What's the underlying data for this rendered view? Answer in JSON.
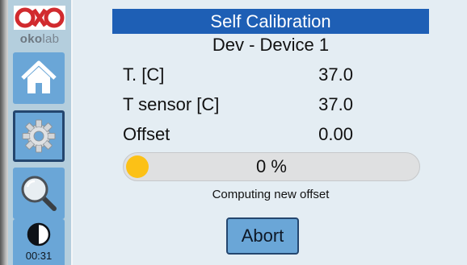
{
  "sidebar": {
    "logo": {
      "text_prefix": "oko",
      "text_suffix": "lab"
    },
    "buttons": [
      {
        "name": "home",
        "icon": "home-icon",
        "selected": false
      },
      {
        "name": "settings",
        "icon": "gear-icon",
        "selected": true
      },
      {
        "name": "search",
        "icon": "magnifier-icon",
        "selected": false
      }
    ],
    "contrast_icon": "contrast-icon",
    "clock": "00:31"
  },
  "screen": {
    "title": "Self Calibration",
    "device": "Dev  - Device 1",
    "rows": [
      {
        "label": "T. [C]",
        "value": "37.0"
      },
      {
        "label": "T sensor [C]",
        "value": "37.0"
      },
      {
        "label": "Offset",
        "value": "0.00"
      }
    ],
    "progress": {
      "percent": 0,
      "text": "0 %",
      "knob_color": "#fcc116"
    },
    "status": "Computing new offset",
    "abort_label": "Abort"
  },
  "colors": {
    "title_bar": "#1e5fb5",
    "sidebar": "#b4cedd",
    "button": "#6aa6d7",
    "button_border": "#24466e",
    "background": "#e4edf3",
    "logo_red": "#d12a2e"
  }
}
